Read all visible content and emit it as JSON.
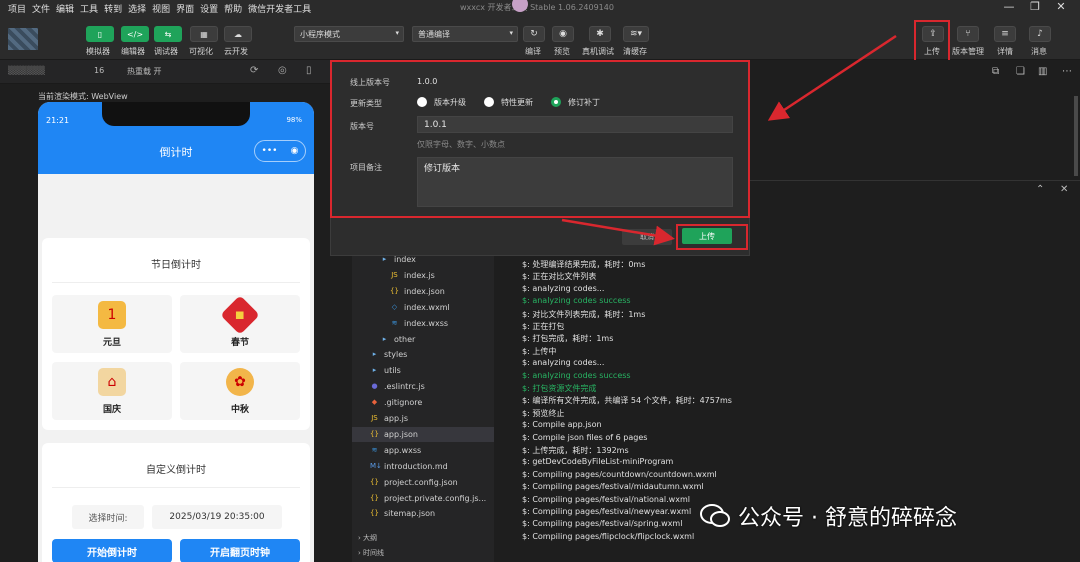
{
  "menu": {
    "items": [
      "项目",
      "文件",
      "编辑",
      "工具",
      "转到",
      "选择",
      "视图",
      "界面",
      "设置",
      "帮助",
      "微信开发者工具"
    ],
    "window_title": "wxxcx 开发者工具 Stable 1.06.2409140"
  },
  "toolbar": {
    "left_buttons": [
      {
        "label": "模拟器",
        "icon": "phone-icon"
      },
      {
        "label": "编辑器",
        "icon": "code-icon"
      },
      {
        "label": "调试器",
        "icon": "debug-icon"
      },
      {
        "label": "可视化",
        "icon": "layout-icon"
      },
      {
        "label": "云开发",
        "icon": "cloud-icon"
      }
    ],
    "mode_select": "小程序模式",
    "compile_select": "普通编译",
    "actions": [
      "编译",
      "预览",
      "真机调试",
      "清缓存"
    ],
    "right_buttons": [
      "上传",
      "版本管理",
      "详情",
      "消息"
    ]
  },
  "subbar": {
    "device": "16",
    "hot_reload": "热重载 开",
    "sim_mode": "当前渲染模式: WebView"
  },
  "phone": {
    "time": "21:21",
    "battery": "98%",
    "nav_title": "倒计时",
    "festival_card_title": "节日倒计时",
    "festivals": [
      {
        "label": "元旦",
        "icon": "calendar-icon",
        "color": "#f4b942"
      },
      {
        "label": "春节",
        "icon": "lucky-icon",
        "color": "#d9272e"
      },
      {
        "label": "国庆",
        "icon": "tiananmen-icon",
        "color": "#f2d6a0"
      },
      {
        "label": "中秋",
        "icon": "mooncake-icon",
        "color": "#f2b54a"
      }
    ],
    "custom_card_title": "自定义倒计时",
    "custom_label": "选择时间:",
    "custom_value": "2025/03/19 20:35:00",
    "start_button": "开始倒计时",
    "flip_button": "开启翻页时钟"
  },
  "dialog": {
    "online_version_label": "线上版本号",
    "online_version": "1.0.0",
    "update_type_label": "更新类型",
    "update_types": [
      "版本升级",
      "特性更新",
      "修订补丁"
    ],
    "selected_update_type": "修订补丁",
    "version_label": "版本号",
    "version_value": "1.0.1",
    "version_hint": "仅限字母、数字、小数点",
    "remark_label": "项目备注",
    "remark_value": "修订版本",
    "cancel_label": "取消",
    "upload_label": "上传"
  },
  "explorer": {
    "items": [
      {
        "label": "index",
        "icon": "folder-icon",
        "indent": 1
      },
      {
        "label": "index.js",
        "icon": "js-file-icon",
        "indent": 2
      },
      {
        "label": "index.json",
        "icon": "json-file-icon",
        "indent": 2
      },
      {
        "label": "index.wxml",
        "icon": "wxml-file-icon",
        "indent": 2
      },
      {
        "label": "index.wxss",
        "icon": "wxss-file-icon",
        "indent": 2
      },
      {
        "label": "other",
        "icon": "folder-icon",
        "indent": 1
      },
      {
        "label": "styles",
        "icon": "folder-icon",
        "indent": 0
      },
      {
        "label": "utils",
        "icon": "folder-icon",
        "indent": 0
      },
      {
        "label": ".eslintrc.js",
        "icon": "eslint-file-icon",
        "indent": 0
      },
      {
        "label": ".gitignore",
        "icon": "git-file-icon",
        "indent": 0
      },
      {
        "label": "app.js",
        "icon": "js-file-icon",
        "indent": 0
      },
      {
        "label": "app.json",
        "icon": "json-file-icon",
        "indent": 0,
        "selected": true
      },
      {
        "label": "app.wxss",
        "icon": "wxss-file-icon",
        "indent": 0
      },
      {
        "label": "introduction.md",
        "icon": "md-file-icon",
        "indent": 0
      },
      {
        "label": "project.config.json",
        "icon": "json-file-icon",
        "indent": 0
      },
      {
        "label": "project.private.config.js...",
        "icon": "json-file-icon",
        "indent": 0
      },
      {
        "label": "sitemap.json",
        "icon": "json-file-icon",
        "indent": 0
      }
    ],
    "outline_label": "大纲",
    "timeline_label": "时间线"
  },
  "console": {
    "lines": [
      {
        "text": "$: 处理编译结果完成，耗时：0ms",
        "green": false
      },
      {
        "text": "$: 正在对比文件列表",
        "green": false
      },
      {
        "text": "$: analyzing codes...",
        "green": false
      },
      {
        "text": "$: analyzing codes success",
        "green": true
      },
      {
        "text": "$: 对比文件列表完成，耗时：1ms",
        "green": false
      },
      {
        "text": "$: 正在打包",
        "green": false
      },
      {
        "text": "$: 打包完成，耗时：1ms",
        "green": false
      },
      {
        "text": "$: 上传中",
        "green": false
      },
      {
        "text": "$: analyzing codes...",
        "green": false
      },
      {
        "text": "$: analyzing codes success",
        "green": true
      },
      {
        "text": "$: 打包资源文件完成",
        "green": true
      },
      {
        "text": "$: 编译所有文件完成，共编译 54 个文件，耗时：4757ms",
        "green": false
      },
      {
        "text": "$: 预览终止",
        "green": false
      },
      {
        "text": "$: Compile app.json",
        "green": false
      },
      {
        "text": "$: Compile json files of 6 pages",
        "green": false
      },
      {
        "text": "$: 上传完成，耗时：1392ms",
        "green": false
      },
      {
        "text": "$: getDevCodeByFileList-miniProgram",
        "green": false
      },
      {
        "text": "$: Compiling pages/countdown/countdown.wxml",
        "green": false
      },
      {
        "text": "$: Compiling pages/festival/midautumn.wxml",
        "green": false
      },
      {
        "text": "$: Compiling pages/festival/national.wxml",
        "green": false
      },
      {
        "text": "$: Compiling pages/festival/newyear.wxml",
        "green": false
      },
      {
        "text": "$: Compiling pages/festival/spring.wxml",
        "green": false
      },
      {
        "text": "$: Compiling pages/flipclock/flipclock.wxml",
        "green": false
      }
    ]
  },
  "watermark": {
    "text": "公众号 · 舒意的碎碎念"
  },
  "colors": {
    "accent_green": "#1fa35a",
    "annotation_red": "#d9272e",
    "phone_blue": "#1f86f4"
  }
}
